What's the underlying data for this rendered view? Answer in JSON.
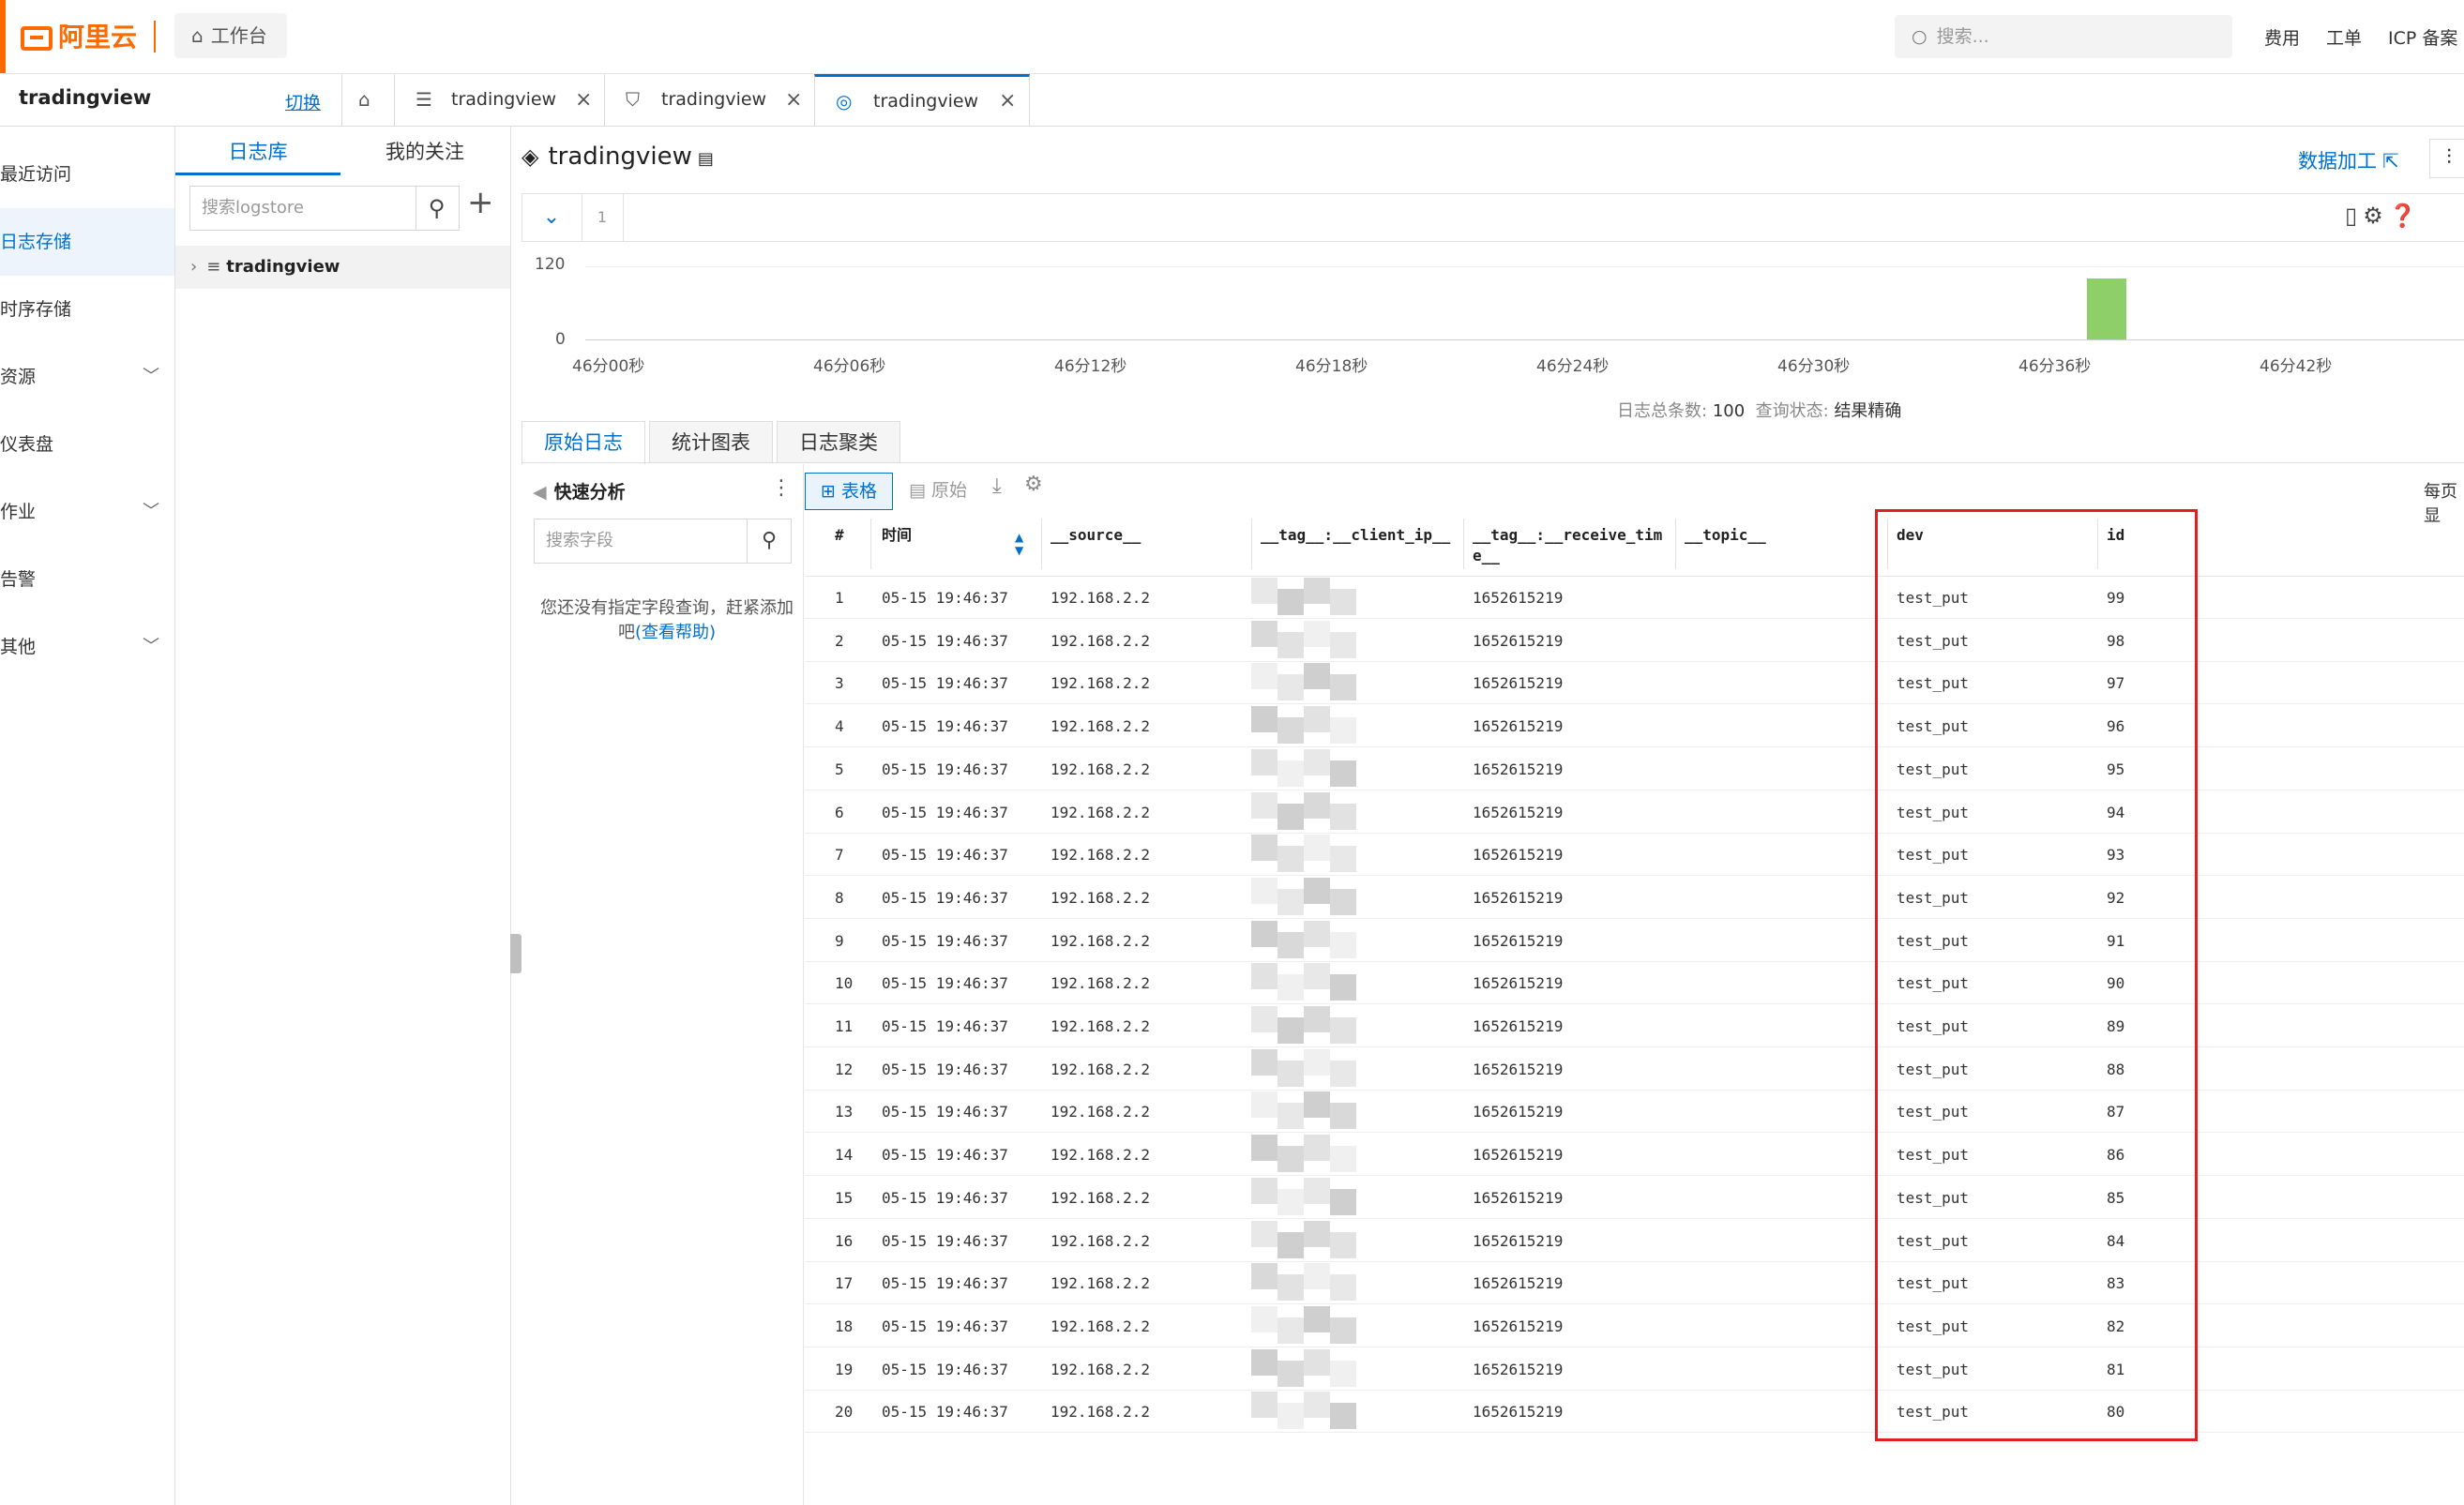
{
  "topbar": {
    "logo": "阿里云",
    "workbench": "工作台",
    "search_placeholder": "搜索...",
    "links": [
      "费用",
      "工单",
      "ICP 备案"
    ]
  },
  "project": {
    "name": "tradingview",
    "switch": "切换"
  },
  "tabs": [
    {
      "label": "tradingview",
      "icon": "database-icon"
    },
    {
      "label": "tradingview",
      "icon": "shield-icon"
    },
    {
      "label": "tradingview",
      "icon": "search-chart-icon",
      "active": true
    }
  ],
  "nav": [
    {
      "label": "最近访问"
    },
    {
      "label": "日志存储",
      "active": true
    },
    {
      "label": "时序存储"
    },
    {
      "label": "资源",
      "expandable": true
    },
    {
      "label": "仪表盘"
    },
    {
      "label": "作业",
      "expandable": true
    },
    {
      "label": "告警"
    },
    {
      "label": "其他",
      "expandable": true
    }
  ],
  "store_panel": {
    "tab_logstores": "日志库",
    "tab_follow": "我的关注",
    "search_placeholder": "搜索logstore",
    "logstore": "tradingview"
  },
  "main": {
    "title": "tradingview",
    "data_processing": "数据加工",
    "query_line": "1"
  },
  "chart_data": {
    "type": "bar",
    "x_ticks": [
      "46分00秒",
      "46分06秒",
      "46分12秒",
      "46分18秒",
      "46分24秒",
      "46分30秒",
      "46分36秒",
      "46分42秒"
    ],
    "y_ticks": [
      "120",
      "0"
    ],
    "ylim": [
      0,
      120
    ],
    "bars": [
      {
        "x": "46分37秒",
        "value": 100
      }
    ]
  },
  "summary": {
    "count_label": "日志总条数:",
    "count": "100",
    "status_label": "查询状态:",
    "status": "结果精确"
  },
  "result_tabs": [
    "原始日志",
    "统计图表",
    "日志聚类"
  ],
  "quick_analysis": {
    "title": "快速分析",
    "search_placeholder": "搜索字段",
    "hint": "您还没有指定字段查询，赶紧添加吧",
    "help": "(查看帮助)"
  },
  "view": {
    "table": "表格",
    "raw": "原始",
    "per_page": "每页显"
  },
  "table": {
    "columns": [
      "#",
      "时间",
      "__source__",
      "__tag__:__client_ip__",
      "__tag__:__receive_tim",
      "e__",
      "__topic__",
      "dev",
      "id"
    ],
    "time": "05-15 19:46:37",
    "source": "192.168.2.2",
    "receive_time": "1652615219",
    "dev": "test_put",
    "rows": [
      {
        "n": "1",
        "id": "99"
      },
      {
        "n": "2",
        "id": "98"
      },
      {
        "n": "3",
        "id": "97"
      },
      {
        "n": "4",
        "id": "96"
      },
      {
        "n": "5",
        "id": "95"
      },
      {
        "n": "6",
        "id": "94"
      },
      {
        "n": "7",
        "id": "93"
      },
      {
        "n": "8",
        "id": "92"
      },
      {
        "n": "9",
        "id": "91"
      },
      {
        "n": "10",
        "id": "90"
      },
      {
        "n": "11",
        "id": "89"
      },
      {
        "n": "12",
        "id": "88"
      },
      {
        "n": "13",
        "id": "87"
      },
      {
        "n": "14",
        "id": "86"
      },
      {
        "n": "15",
        "id": "85"
      },
      {
        "n": "16",
        "id": "84"
      },
      {
        "n": "17",
        "id": "83"
      },
      {
        "n": "18",
        "id": "82"
      },
      {
        "n": "19",
        "id": "81"
      },
      {
        "n": "20",
        "id": "80"
      }
    ]
  },
  "colors": {
    "accent": "#0070cc",
    "brand": "#ff6a00",
    "highlight": "#e02020",
    "bar": "#8ecf6a"
  }
}
